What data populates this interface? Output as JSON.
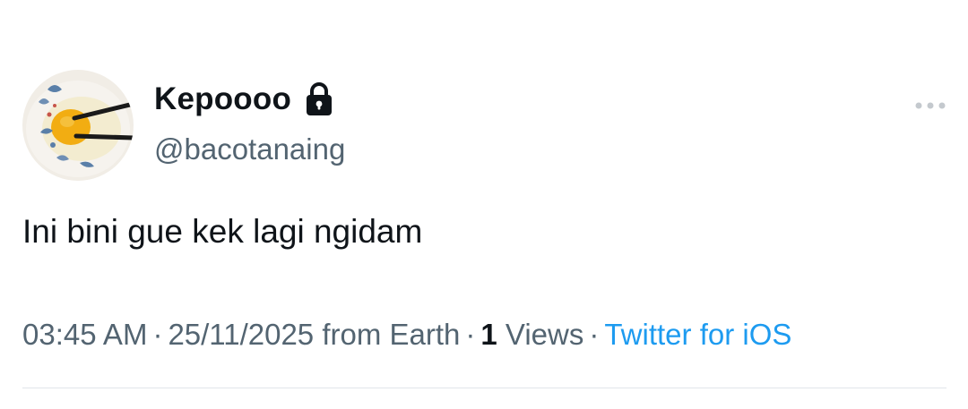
{
  "author": {
    "display_name": "Kepoooo",
    "handle": "@bacotanaing",
    "protected_icon": "lock-icon",
    "avatar_icon": "egg-yolk-bowl-avatar"
  },
  "tweet": {
    "text": "Ini bini gue kek lagi ngidam"
  },
  "meta": {
    "time": "03:45 AM",
    "separator": "·",
    "date_location": "25/11/2025 from Earth",
    "views_count": "1",
    "views_label": "Views",
    "source": "Twitter for iOS"
  },
  "actions": {
    "more_icon": "more-dots-icon"
  },
  "colors": {
    "primary_text": "#0f1419",
    "secondary_text": "#536471",
    "link": "#1d9bf0",
    "divider": "#e1e6ea"
  }
}
